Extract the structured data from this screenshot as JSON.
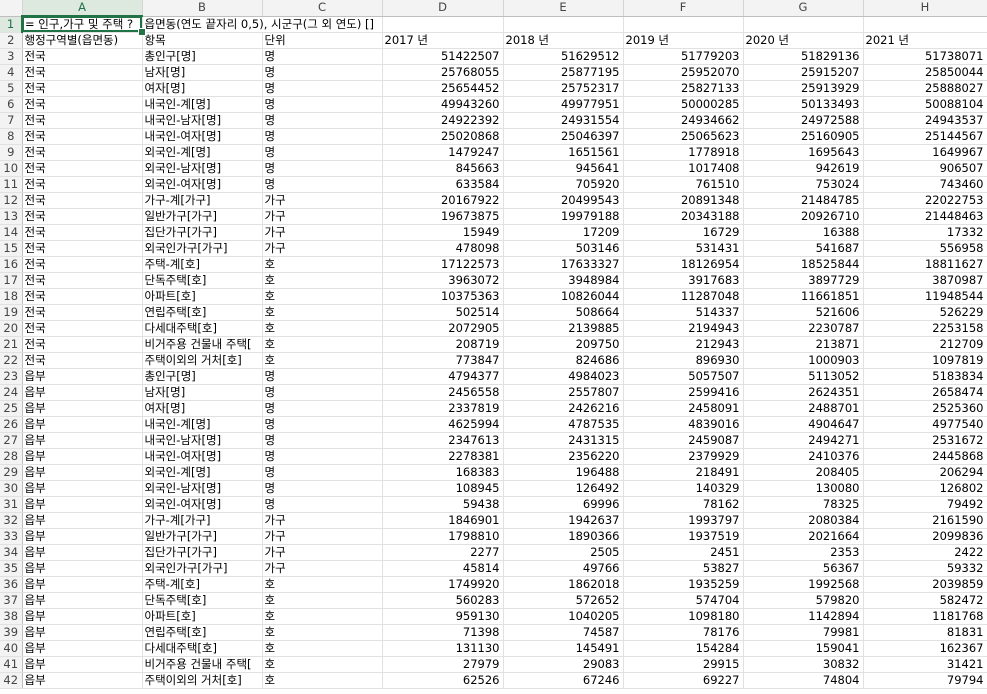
{
  "columns": [
    "A",
    "B",
    "C",
    "D",
    "E",
    "F",
    "G",
    "H"
  ],
  "selected_column": "A",
  "active_cell": "A1",
  "title_overlay_a1": "= 인구,가구 및 주택 ?",
  "title_full": "= 인구,가구 및 주택 ? 읍면동(연도 끝자리 0,5), 시군구(그 외 연도) []",
  "title_overlay_b1": "읍면동(연도 끝자리 0,5), 시군구(그 외 연도) []",
  "header_row": [
    "행정구역별(읍면동)",
    "항목",
    "단위",
    "2017 년",
    "2018 년",
    "2019 년",
    "2020 년",
    "2021 년"
  ],
  "rows": [
    [
      "전국",
      "총인구[명]",
      "명",
      "51422507",
      "51629512",
      "51779203",
      "51829136",
      "51738071"
    ],
    [
      "전국",
      "남자[명]",
      "명",
      "25768055",
      "25877195",
      "25952070",
      "25915207",
      "25850044"
    ],
    [
      "전국",
      "여자[명]",
      "명",
      "25654452",
      "25752317",
      "25827133",
      "25913929",
      "25888027"
    ],
    [
      "전국",
      "내국인-계[명]",
      "명",
      "49943260",
      "49977951",
      "50000285",
      "50133493",
      "50088104"
    ],
    [
      "전국",
      "내국인-남자[명]",
      "명",
      "24922392",
      "24931554",
      "24934662",
      "24972588",
      "24943537"
    ],
    [
      "전국",
      "내국인-여자[명]",
      "명",
      "25020868",
      "25046397",
      "25065623",
      "25160905",
      "25144567"
    ],
    [
      "전국",
      "외국인-계[명]",
      "명",
      "1479247",
      "1651561",
      "1778918",
      "1695643",
      "1649967"
    ],
    [
      "전국",
      "외국인-남자[명]",
      "명",
      "845663",
      "945641",
      "1017408",
      "942619",
      "906507"
    ],
    [
      "전국",
      "외국인-여자[명]",
      "명",
      "633584",
      "705920",
      "761510",
      "753024",
      "743460"
    ],
    [
      "전국",
      "가구-계[가구]",
      "가구",
      "20167922",
      "20499543",
      "20891348",
      "21484785",
      "22022753"
    ],
    [
      "전국",
      "일반가구[가구]",
      "가구",
      "19673875",
      "19979188",
      "20343188",
      "20926710",
      "21448463"
    ],
    [
      "전국",
      "집단가구[가구]",
      "가구",
      "15949",
      "17209",
      "16729",
      "16388",
      "17332"
    ],
    [
      "전국",
      "외국인가구[가구]",
      "가구",
      "478098",
      "503146",
      "531431",
      "541687",
      "556958"
    ],
    [
      "전국",
      "주택-계[호]",
      "호",
      "17122573",
      "17633327",
      "18126954",
      "18525844",
      "18811627"
    ],
    [
      "전국",
      "단독주택[호]",
      "호",
      "3963072",
      "3948984",
      "3917683",
      "3897729",
      "3870987"
    ],
    [
      "전국",
      "아파트[호]",
      "호",
      "10375363",
      "10826044",
      "11287048",
      "11661851",
      "11948544"
    ],
    [
      "전국",
      "연립주택[호]",
      "호",
      "502514",
      "508664",
      "514337",
      "521606",
      "526229"
    ],
    [
      "전국",
      "다세대주택[호]",
      "호",
      "2072905",
      "2139885",
      "2194943",
      "2230787",
      "2253158"
    ],
    [
      "전국",
      "비거주용 건물내 주택[",
      "호",
      "208719",
      "209750",
      "212943",
      "213871",
      "212709"
    ],
    [
      "전국",
      "주택이외의 거처[호]",
      "호",
      "773847",
      "824686",
      "896930",
      "1000903",
      "1097819"
    ],
    [
      "읍부",
      "총인구[명]",
      "명",
      "4794377",
      "4984023",
      "5057507",
      "5113052",
      "5183834"
    ],
    [
      "읍부",
      "남자[명]",
      "명",
      "2456558",
      "2557807",
      "2599416",
      "2624351",
      "2658474"
    ],
    [
      "읍부",
      "여자[명]",
      "명",
      "2337819",
      "2426216",
      "2458091",
      "2488701",
      "2525360"
    ],
    [
      "읍부",
      "내국인-계[명]",
      "명",
      "4625994",
      "4787535",
      "4839016",
      "4904647",
      "4977540"
    ],
    [
      "읍부",
      "내국인-남자[명]",
      "명",
      "2347613",
      "2431315",
      "2459087",
      "2494271",
      "2531672"
    ],
    [
      "읍부",
      "내국인-여자[명]",
      "명",
      "2278381",
      "2356220",
      "2379929",
      "2410376",
      "2445868"
    ],
    [
      "읍부",
      "외국인-계[명]",
      "명",
      "168383",
      "196488",
      "218491",
      "208405",
      "206294"
    ],
    [
      "읍부",
      "외국인-남자[명]",
      "명",
      "108945",
      "126492",
      "140329",
      "130080",
      "126802"
    ],
    [
      "읍부",
      "외국인-여자[명]",
      "명",
      "59438",
      "69996",
      "78162",
      "78325",
      "79492"
    ],
    [
      "읍부",
      "가구-계[가구]",
      "가구",
      "1846901",
      "1942637",
      "1993797",
      "2080384",
      "2161590"
    ],
    [
      "읍부",
      "일반가구[가구]",
      "가구",
      "1798810",
      "1890366",
      "1937519",
      "2021664",
      "2099836"
    ],
    [
      "읍부",
      "집단가구[가구]",
      "가구",
      "2277",
      "2505",
      "2451",
      "2353",
      "2422"
    ],
    [
      "읍부",
      "외국인가구[가구]",
      "가구",
      "45814",
      "49766",
      "53827",
      "56367",
      "59332"
    ],
    [
      "읍부",
      "주택-계[호]",
      "호",
      "1749920",
      "1862018",
      "1935259",
      "1992568",
      "2039859"
    ],
    [
      "읍부",
      "단독주택[호]",
      "호",
      "560283",
      "572652",
      "574704",
      "579820",
      "582472"
    ],
    [
      "읍부",
      "아파트[호]",
      "호",
      "959130",
      "1040205",
      "1098180",
      "1142894",
      "1181768"
    ],
    [
      "읍부",
      "연립주택[호]",
      "호",
      "71398",
      "74587",
      "78176",
      "79981",
      "81831"
    ],
    [
      "읍부",
      "다세대주택[호]",
      "호",
      "131130",
      "145491",
      "154284",
      "159041",
      "162367"
    ],
    [
      "읍부",
      "비거주용 건물내 주택[",
      "호",
      "27979",
      "29083",
      "29915",
      "30832",
      "31421"
    ],
    [
      "읍부",
      "주택이외의 거처[호]",
      "호",
      "62526",
      "67246",
      "69227",
      "74804",
      "79794"
    ]
  ],
  "colors": {
    "selection": "#217346",
    "header_bg": "#f3f3f3",
    "gridline": "#e1e1e1"
  }
}
